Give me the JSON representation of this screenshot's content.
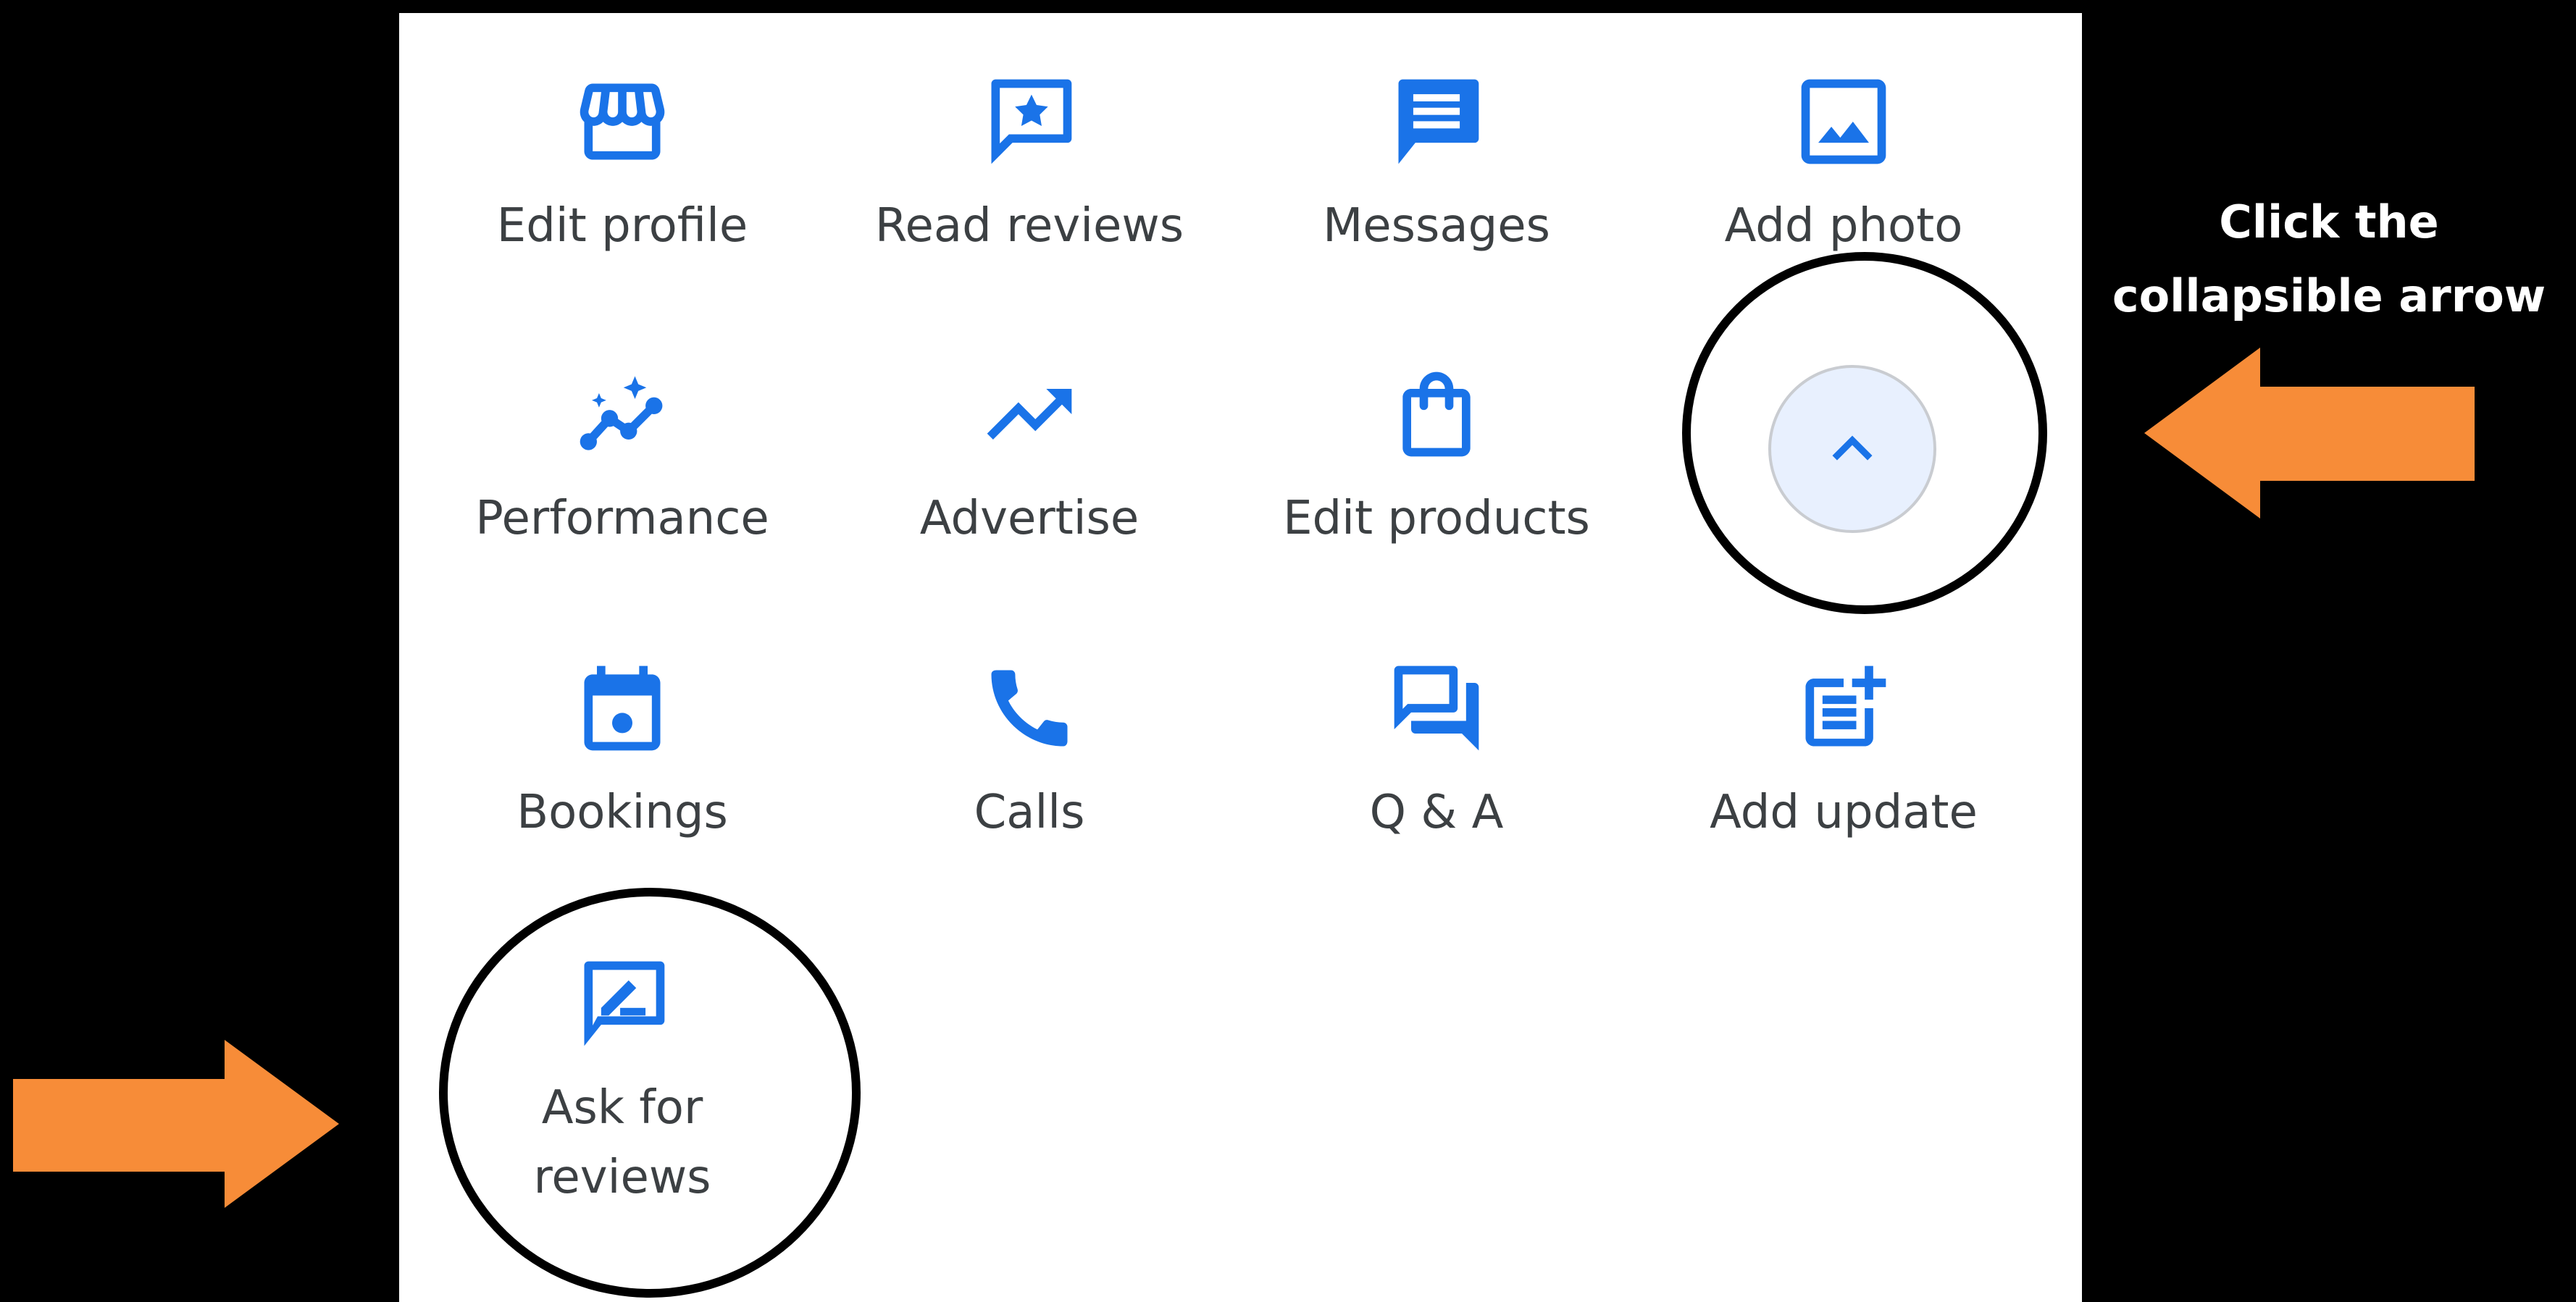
{
  "colors": {
    "icon": "#1a73e8",
    "label": "#3c4043",
    "panel": "#ffffff",
    "background": "#000000",
    "arrow": "#f78c38",
    "button_fill": "#e8f0fe"
  },
  "grid": {
    "tiles": [
      {
        "label": "Edit profile",
        "icon": "storefront-icon"
      },
      {
        "label": "Read reviews",
        "icon": "review-star-icon"
      },
      {
        "label": "Messages",
        "icon": "message-icon"
      },
      {
        "label": "Add photo",
        "icon": "photo-icon"
      },
      {
        "label": "Performance",
        "icon": "performance-icon"
      },
      {
        "label": "Advertise",
        "icon": "trending-up-icon"
      },
      {
        "label": "Edit products",
        "icon": "shopping-bag-icon"
      },
      {
        "label": "Bookings",
        "icon": "calendar-icon"
      },
      {
        "label": "Calls",
        "icon": "phone-icon"
      },
      {
        "label": "Q & A",
        "icon": "forum-icon"
      },
      {
        "label": "Add update",
        "icon": "post-add-icon"
      },
      {
        "label": "Ask for\nreviews",
        "icon": "rate-review-icon"
      }
    ],
    "collapse_button_icon": "chevron-up-icon"
  },
  "annotation": {
    "line1": "Click the",
    "line2": "collapsible arrow"
  }
}
